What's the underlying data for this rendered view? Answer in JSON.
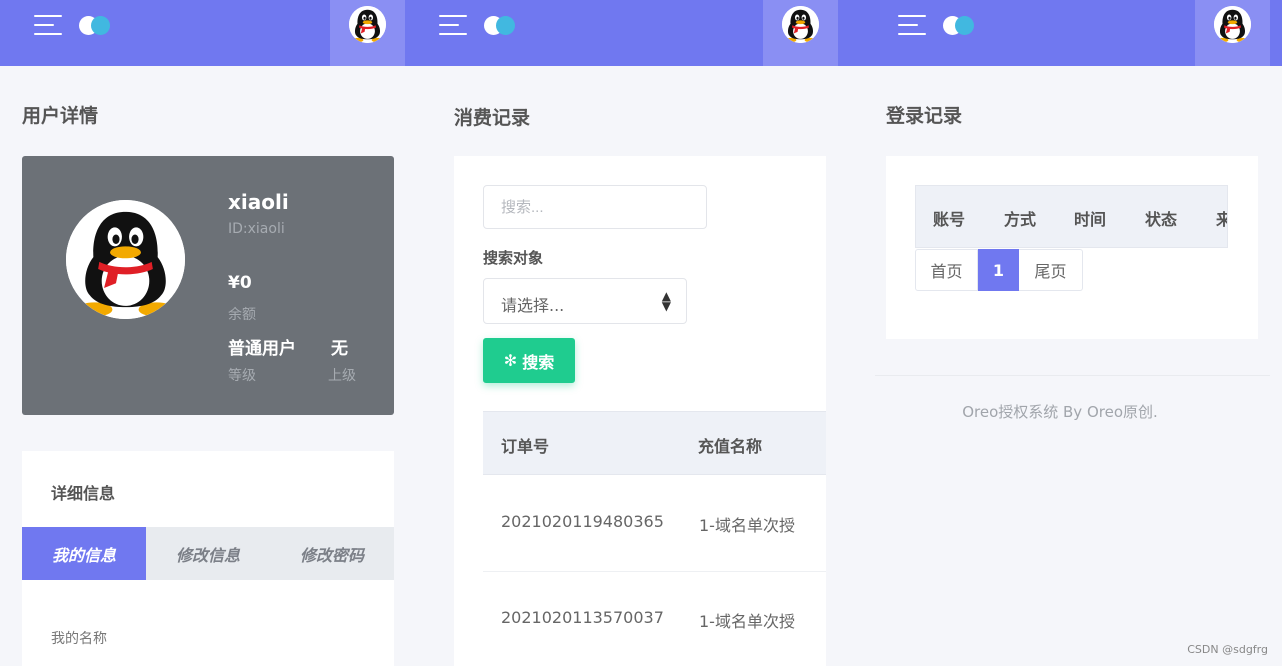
{
  "colors": {
    "primary": "#7078f0",
    "success": "#1fcc8f",
    "card_dark": "#6c7177"
  },
  "icons": {
    "menu": "menu-icon",
    "theme_toggle": "toggle-icon",
    "avatar": "qq-penguin-avatar",
    "search": "snowflake-icon"
  },
  "panel1": {
    "title": "用户详情",
    "user": {
      "name": "xiaoli",
      "id": "ID:xiaoli",
      "balance": "¥0",
      "balance_label": "余额",
      "level": "普通用户",
      "level_label": "等级",
      "parent": "无",
      "parent_label": "上级"
    },
    "detail": {
      "title": "详细信息",
      "tabs": [
        {
          "label": "我的信息",
          "active": true
        },
        {
          "label": "修改信息",
          "active": false
        },
        {
          "label": "修改密码",
          "active": false
        }
      ],
      "field_label": "我的名称"
    }
  },
  "panel2": {
    "title": "消费记录",
    "search_placeholder": "搜索...",
    "search_target_label": "搜索对象",
    "select_value": "请选择...",
    "search_button": "搜索",
    "columns": [
      "订单号",
      "充值名称"
    ],
    "rows": [
      {
        "order": "2021020119480365",
        "name": "1-域名单次授"
      },
      {
        "order": "2021020113570037",
        "name": "1-域名单次授"
      }
    ]
  },
  "panel3": {
    "title": "登录记录",
    "columns": [
      "账号",
      "方式",
      "时间",
      "状态",
      "来"
    ],
    "pager": {
      "first": "首页",
      "current": "1",
      "last": "尾页"
    },
    "footer": "Oreo授权系统 By Oreo原创."
  },
  "watermark": "CSDN @sdgfrg"
}
